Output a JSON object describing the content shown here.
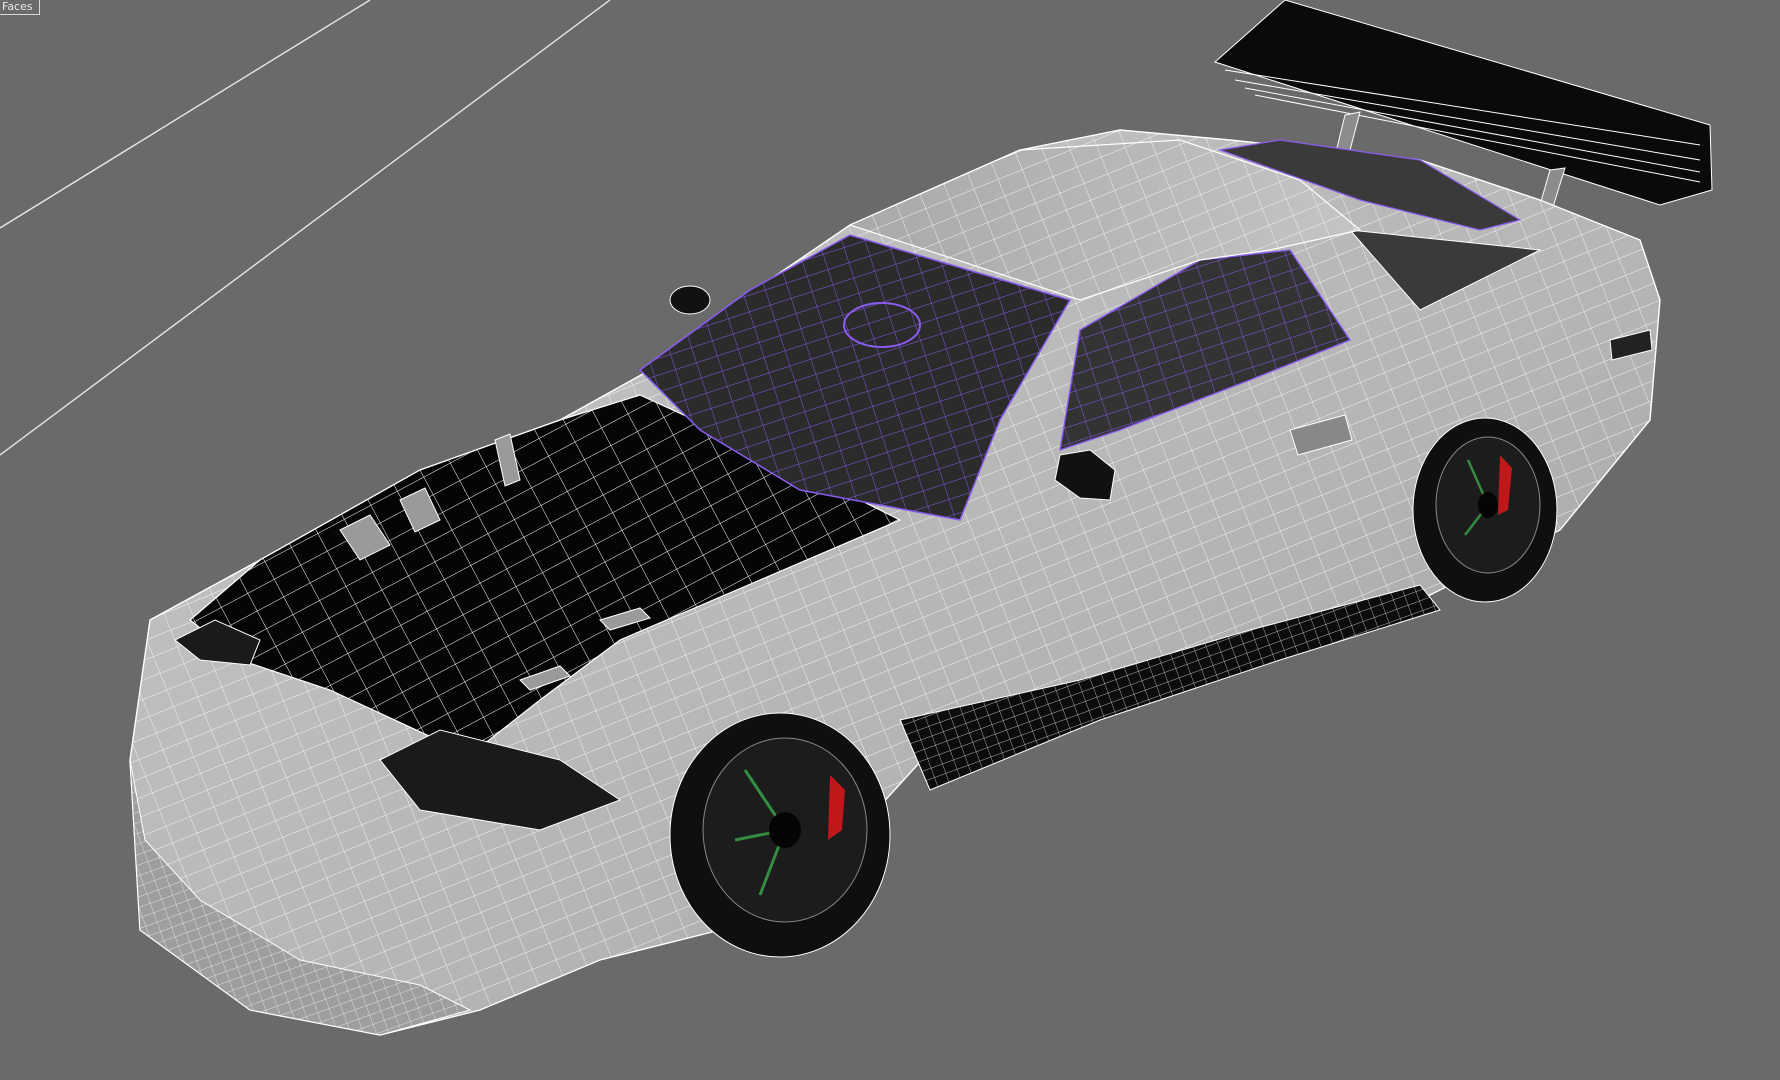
{
  "viewport": {
    "label": "Faces",
    "background_color": "#6a6a6a"
  },
  "scene": {
    "object": "car-model-wireframe",
    "shading_mode": "shaded-with-edged-faces",
    "colors": {
      "body_shaded": "#bdbdbd",
      "body_shadow": "#8c8c8c",
      "wire": "#ffffff",
      "hood_black": "#050505",
      "selection_wire": "#8a5cf0",
      "glass": "#2b2b2b",
      "brake_caliper": "#c0181a",
      "rim_highlight_green": "#3aa84a"
    }
  }
}
